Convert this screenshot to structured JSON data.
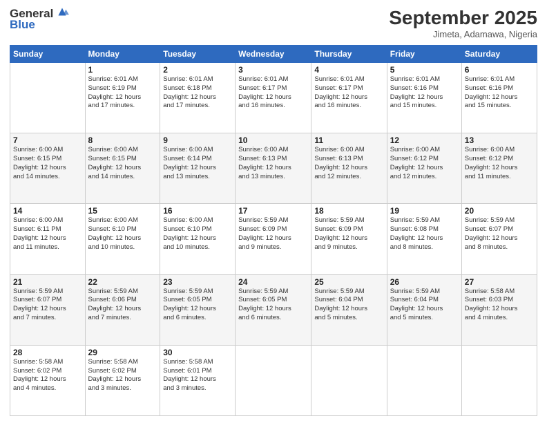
{
  "logo": {
    "line1": "General",
    "line2": "Blue"
  },
  "title": "September 2025",
  "location": "Jimeta, Adamawa, Nigeria",
  "days_of_week": [
    "Sunday",
    "Monday",
    "Tuesday",
    "Wednesday",
    "Thursday",
    "Friday",
    "Saturday"
  ],
  "weeks": [
    [
      {
        "day": "",
        "info": ""
      },
      {
        "day": "1",
        "info": "Sunrise: 6:01 AM\nSunset: 6:19 PM\nDaylight: 12 hours\nand 17 minutes."
      },
      {
        "day": "2",
        "info": "Sunrise: 6:01 AM\nSunset: 6:18 PM\nDaylight: 12 hours\nand 17 minutes."
      },
      {
        "day": "3",
        "info": "Sunrise: 6:01 AM\nSunset: 6:17 PM\nDaylight: 12 hours\nand 16 minutes."
      },
      {
        "day": "4",
        "info": "Sunrise: 6:01 AM\nSunset: 6:17 PM\nDaylight: 12 hours\nand 16 minutes."
      },
      {
        "day": "5",
        "info": "Sunrise: 6:01 AM\nSunset: 6:16 PM\nDaylight: 12 hours\nand 15 minutes."
      },
      {
        "day": "6",
        "info": "Sunrise: 6:01 AM\nSunset: 6:16 PM\nDaylight: 12 hours\nand 15 minutes."
      }
    ],
    [
      {
        "day": "7",
        "info": "Sunrise: 6:00 AM\nSunset: 6:15 PM\nDaylight: 12 hours\nand 14 minutes."
      },
      {
        "day": "8",
        "info": "Sunrise: 6:00 AM\nSunset: 6:15 PM\nDaylight: 12 hours\nand 14 minutes."
      },
      {
        "day": "9",
        "info": "Sunrise: 6:00 AM\nSunset: 6:14 PM\nDaylight: 12 hours\nand 13 minutes."
      },
      {
        "day": "10",
        "info": "Sunrise: 6:00 AM\nSunset: 6:13 PM\nDaylight: 12 hours\nand 13 minutes."
      },
      {
        "day": "11",
        "info": "Sunrise: 6:00 AM\nSunset: 6:13 PM\nDaylight: 12 hours\nand 12 minutes."
      },
      {
        "day": "12",
        "info": "Sunrise: 6:00 AM\nSunset: 6:12 PM\nDaylight: 12 hours\nand 12 minutes."
      },
      {
        "day": "13",
        "info": "Sunrise: 6:00 AM\nSunset: 6:12 PM\nDaylight: 12 hours\nand 11 minutes."
      }
    ],
    [
      {
        "day": "14",
        "info": "Sunrise: 6:00 AM\nSunset: 6:11 PM\nDaylight: 12 hours\nand 11 minutes."
      },
      {
        "day": "15",
        "info": "Sunrise: 6:00 AM\nSunset: 6:10 PM\nDaylight: 12 hours\nand 10 minutes."
      },
      {
        "day": "16",
        "info": "Sunrise: 6:00 AM\nSunset: 6:10 PM\nDaylight: 12 hours\nand 10 minutes."
      },
      {
        "day": "17",
        "info": "Sunrise: 5:59 AM\nSunset: 6:09 PM\nDaylight: 12 hours\nand 9 minutes."
      },
      {
        "day": "18",
        "info": "Sunrise: 5:59 AM\nSunset: 6:09 PM\nDaylight: 12 hours\nand 9 minutes."
      },
      {
        "day": "19",
        "info": "Sunrise: 5:59 AM\nSunset: 6:08 PM\nDaylight: 12 hours\nand 8 minutes."
      },
      {
        "day": "20",
        "info": "Sunrise: 5:59 AM\nSunset: 6:07 PM\nDaylight: 12 hours\nand 8 minutes."
      }
    ],
    [
      {
        "day": "21",
        "info": "Sunrise: 5:59 AM\nSunset: 6:07 PM\nDaylight: 12 hours\nand 7 minutes."
      },
      {
        "day": "22",
        "info": "Sunrise: 5:59 AM\nSunset: 6:06 PM\nDaylight: 12 hours\nand 7 minutes."
      },
      {
        "day": "23",
        "info": "Sunrise: 5:59 AM\nSunset: 6:05 PM\nDaylight: 12 hours\nand 6 minutes."
      },
      {
        "day": "24",
        "info": "Sunrise: 5:59 AM\nSunset: 6:05 PM\nDaylight: 12 hours\nand 6 minutes."
      },
      {
        "day": "25",
        "info": "Sunrise: 5:59 AM\nSunset: 6:04 PM\nDaylight: 12 hours\nand 5 minutes."
      },
      {
        "day": "26",
        "info": "Sunrise: 5:59 AM\nSunset: 6:04 PM\nDaylight: 12 hours\nand 5 minutes."
      },
      {
        "day": "27",
        "info": "Sunrise: 5:58 AM\nSunset: 6:03 PM\nDaylight: 12 hours\nand 4 minutes."
      }
    ],
    [
      {
        "day": "28",
        "info": "Sunrise: 5:58 AM\nSunset: 6:02 PM\nDaylight: 12 hours\nand 4 minutes."
      },
      {
        "day": "29",
        "info": "Sunrise: 5:58 AM\nSunset: 6:02 PM\nDaylight: 12 hours\nand 3 minutes."
      },
      {
        "day": "30",
        "info": "Sunrise: 5:58 AM\nSunset: 6:01 PM\nDaylight: 12 hours\nand 3 minutes."
      },
      {
        "day": "",
        "info": ""
      },
      {
        "day": "",
        "info": ""
      },
      {
        "day": "",
        "info": ""
      },
      {
        "day": "",
        "info": ""
      }
    ]
  ]
}
